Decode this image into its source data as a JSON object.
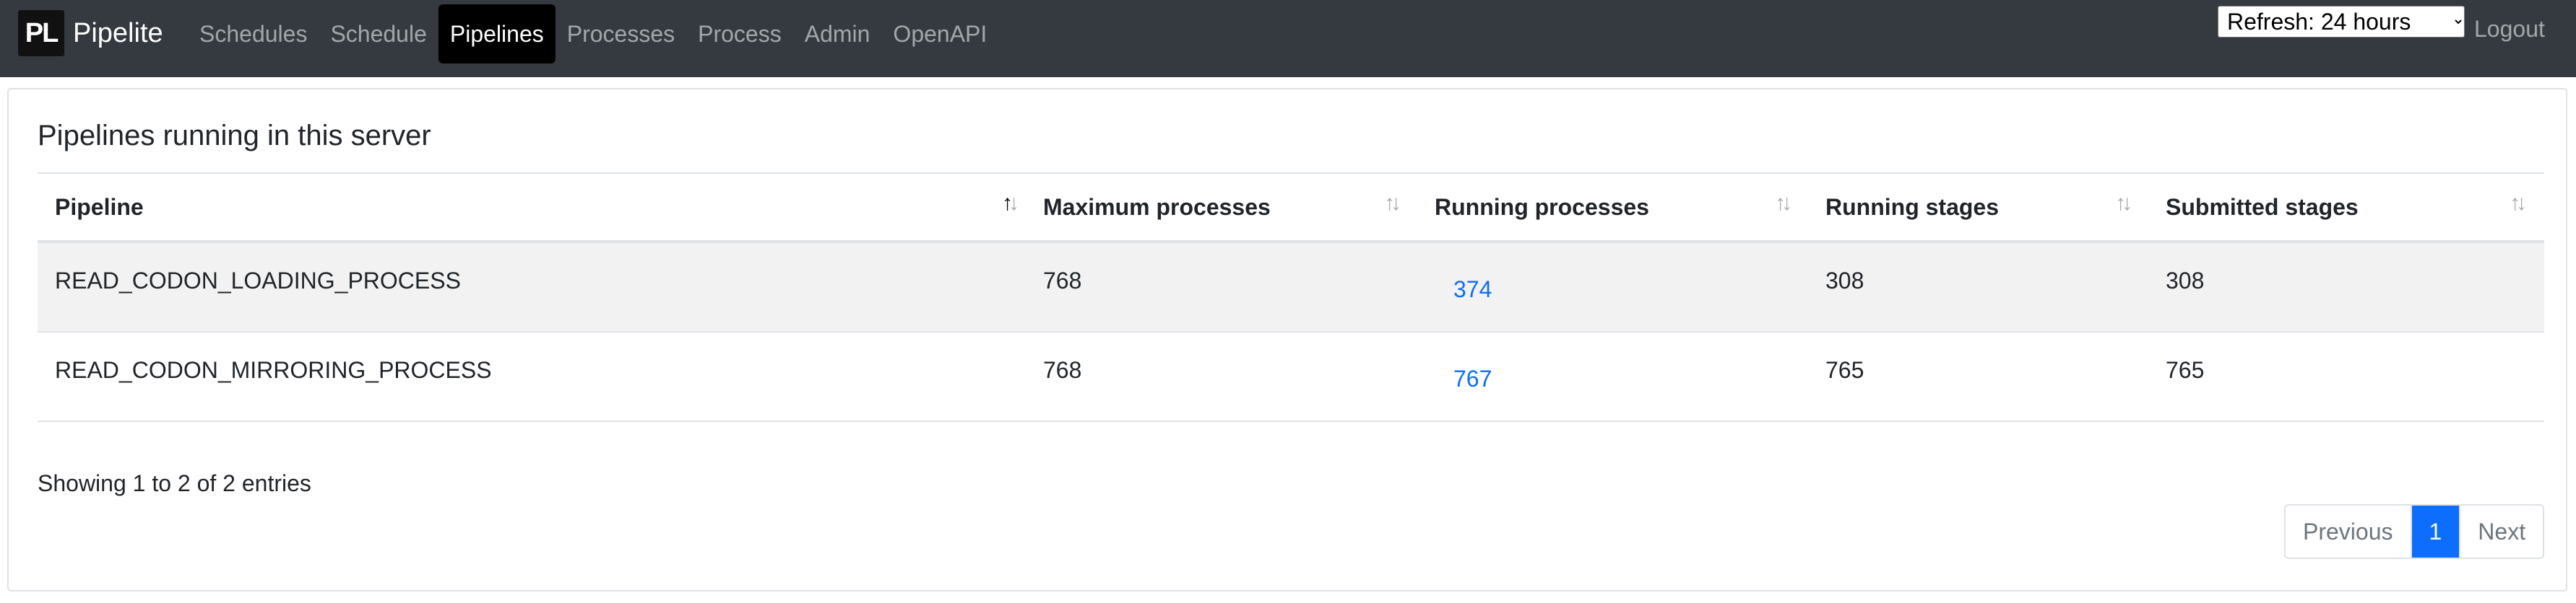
{
  "brand": {
    "logo_text": "PL",
    "name": "Pipelite"
  },
  "nav": {
    "items": [
      {
        "label": "Schedules"
      },
      {
        "label": "Schedule"
      },
      {
        "label": "Pipelines"
      },
      {
        "label": "Processes"
      },
      {
        "label": "Process"
      },
      {
        "label": "Admin"
      },
      {
        "label": "OpenAPI"
      }
    ],
    "active": "Pipelines",
    "refresh_selected": "Refresh: 24 hours",
    "logout_label": "Logout"
  },
  "card": {
    "title": "Pipelines running in this server",
    "columns": [
      "Pipeline",
      "Maximum processes",
      "Running processes",
      "Running stages",
      "Submitted stages"
    ],
    "rows": [
      [
        "READ_CODON_LOADING_PROCESS",
        "768",
        "374",
        "308",
        "308"
      ],
      [
        "READ_CODON_MIRRORING_PROCESS",
        "768",
        "767",
        "765",
        "765"
      ]
    ],
    "info": "Showing 1 to 2 of 2 entries",
    "pagination": {
      "previous": "Previous",
      "current": "1",
      "next": "Next"
    }
  },
  "colors": {
    "navbar": "#343a40",
    "link": "#0d6efd",
    "active_page": "#0d6efd"
  },
  "icons": {
    "sort": "sort-arrows-icon",
    "select": "chevron-down-icon"
  }
}
